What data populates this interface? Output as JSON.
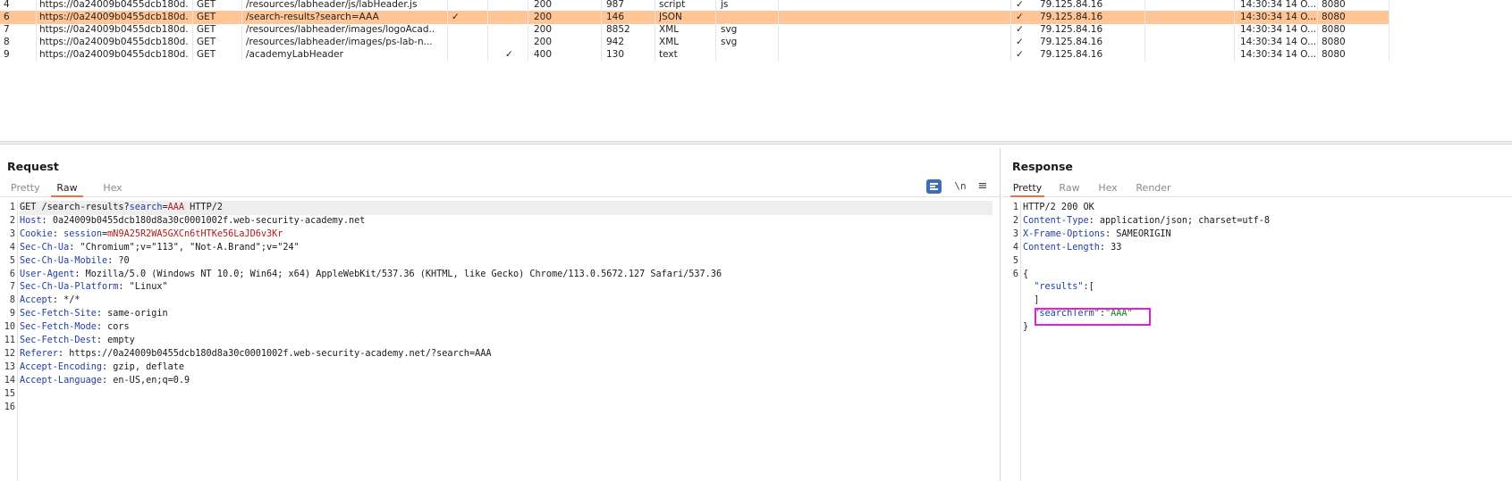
{
  "history": {
    "rows": [
      {
        "num": "4",
        "host": "https://0a24009b0455dcb180d...",
        "method": "GET",
        "url": "/resources/labheader/js/labHeader.js",
        "params": "",
        "edited": "",
        "status": "200",
        "length": "987",
        "mime": "script",
        "ext": "js",
        "tls": "✓",
        "ip": "79.125.84.16",
        "time": "14:30:34 14 O...",
        "port": "8080",
        "selected": false
      },
      {
        "num": "6",
        "host": "https://0a24009b0455dcb180d...",
        "method": "GET",
        "url": "/search-results?search=AAA",
        "params": "✓",
        "edited": "",
        "status": "200",
        "length": "146",
        "mime": "JSON",
        "ext": "",
        "tls": "✓",
        "ip": "79.125.84.16",
        "time": "14:30:34 14 O...",
        "port": "8080",
        "selected": true
      },
      {
        "num": "7",
        "host": "https://0a24009b0455dcb180d...",
        "method": "GET",
        "url": "/resources/labheader/images/logoAcad...",
        "params": "",
        "edited": "",
        "status": "200",
        "length": "8852",
        "mime": "XML",
        "ext": "svg",
        "tls": "✓",
        "ip": "79.125.84.16",
        "time": "14:30:34 14 O...",
        "port": "8080",
        "selected": false
      },
      {
        "num": "8",
        "host": "https://0a24009b0455dcb180d...",
        "method": "GET",
        "url": "/resources/labheader/images/ps-lab-n...",
        "params": "",
        "edited": "",
        "status": "200",
        "length": "942",
        "mime": "XML",
        "ext": "svg",
        "tls": "✓",
        "ip": "79.125.84.16",
        "time": "14:30:34 14 O...",
        "port": "8080",
        "selected": false
      },
      {
        "num": "9",
        "host": "https://0a24009b0455dcb180d...",
        "method": "GET",
        "url": "/academyLabHeader",
        "params": "",
        "edited": "✓",
        "status": "400",
        "length": "130",
        "mime": "text",
        "ext": "",
        "tls": "✓",
        "ip": "79.125.84.16",
        "time": "14:30:34 14 O...",
        "port": "8080",
        "selected": false
      }
    ]
  },
  "request": {
    "title": "Request",
    "tabs": [
      "Pretty",
      "Raw",
      "Hex"
    ],
    "active_tab": "Raw",
    "newline_label": "\\n",
    "menu_icon": "≡",
    "lines": [
      {
        "n": "1",
        "parts": [
          {
            "t": "GET /search-results?",
            "c": ""
          },
          {
            "t": "search",
            "c": "k"
          },
          {
            "t": "=",
            "c": ""
          },
          {
            "t": "AAA",
            "c": "v"
          },
          {
            "t": " HTTP/2",
            "c": ""
          }
        ]
      },
      {
        "n": "2",
        "parts": [
          {
            "t": "Host",
            "c": "k"
          },
          {
            "t": ": 0a24009b0455dcb180d8a30c0001002f.web-security-academy.net",
            "c": ""
          }
        ]
      },
      {
        "n": "3",
        "parts": [
          {
            "t": "Cookie",
            "c": "k"
          },
          {
            "t": ": ",
            "c": ""
          },
          {
            "t": "session",
            "c": "k"
          },
          {
            "t": "=",
            "c": ""
          },
          {
            "t": "mN9A25R2WA5GXCn6tHTKe56LaJD6v3Kr",
            "c": "v"
          }
        ]
      },
      {
        "n": "4",
        "parts": [
          {
            "t": "Sec-Ch-Ua",
            "c": "k"
          },
          {
            "t": ": \"Chromium\";v=\"113\", \"Not-A.Brand\";v=\"24\"",
            "c": ""
          }
        ]
      },
      {
        "n": "5",
        "parts": [
          {
            "t": "Sec-Ch-Ua-Mobile",
            "c": "k"
          },
          {
            "t": ": ?0",
            "c": ""
          }
        ]
      },
      {
        "n": "6",
        "parts": [
          {
            "t": "User-Agent",
            "c": "k"
          },
          {
            "t": ": Mozilla/5.0 (Windows NT 10.0; Win64; x64) AppleWebKit/537.36 (KHTML, like Gecko) Chrome/113.0.5672.127 Safari/537.36",
            "c": ""
          }
        ]
      },
      {
        "n": "7",
        "parts": [
          {
            "t": "Sec-Ch-Ua-Platform",
            "c": "k"
          },
          {
            "t": ": \"Linux\"",
            "c": ""
          }
        ]
      },
      {
        "n": "8",
        "parts": [
          {
            "t": "Accept",
            "c": "k"
          },
          {
            "t": ": */*",
            "c": ""
          }
        ]
      },
      {
        "n": "9",
        "parts": [
          {
            "t": "Sec-Fetch-Site",
            "c": "k"
          },
          {
            "t": ": same-origin",
            "c": ""
          }
        ]
      },
      {
        "n": "10",
        "parts": [
          {
            "t": "Sec-Fetch-Mode",
            "c": "k"
          },
          {
            "t": ": cors",
            "c": ""
          }
        ]
      },
      {
        "n": "11",
        "parts": [
          {
            "t": "Sec-Fetch-Dest",
            "c": "k"
          },
          {
            "t": ": empty",
            "c": ""
          }
        ]
      },
      {
        "n": "12",
        "parts": [
          {
            "t": "Referer",
            "c": "k"
          },
          {
            "t": ": https://0a24009b0455dcb180d8a30c0001002f.web-security-academy.net/?search=AAA",
            "c": ""
          }
        ]
      },
      {
        "n": "13",
        "parts": [
          {
            "t": "Accept-Encoding",
            "c": "k"
          },
          {
            "t": ": gzip, deflate",
            "c": ""
          }
        ]
      },
      {
        "n": "14",
        "parts": [
          {
            "t": "Accept-Language",
            "c": "k"
          },
          {
            "t": ": en-US,en;q=0.9",
            "c": ""
          }
        ]
      },
      {
        "n": "15",
        "parts": []
      },
      {
        "n": "16",
        "parts": []
      }
    ]
  },
  "response": {
    "title": "Response",
    "tabs": [
      "Pretty",
      "Raw",
      "Hex",
      "Render"
    ],
    "active_tab": "Pretty",
    "lines": [
      {
        "n": "1",
        "parts": [
          {
            "t": "HTTP/2 200 OK",
            "c": ""
          }
        ]
      },
      {
        "n": "2",
        "parts": [
          {
            "t": "Content-Type",
            "c": "k"
          },
          {
            "t": ": application/json; charset=utf-8",
            "c": ""
          }
        ]
      },
      {
        "n": "3",
        "parts": [
          {
            "t": "X-Frame-Options",
            "c": "k"
          },
          {
            "t": ": SAMEORIGIN",
            "c": ""
          }
        ]
      },
      {
        "n": "4",
        "parts": [
          {
            "t": "Content-Length",
            "c": "k"
          },
          {
            "t": ": 33",
            "c": ""
          }
        ]
      },
      {
        "n": "5",
        "parts": []
      },
      {
        "n": "6",
        "parts": [
          {
            "t": "{",
            "c": ""
          }
        ]
      },
      {
        "n": "",
        "parts": [
          {
            "t": "  \"results\"",
            "c": "json-key"
          },
          {
            "t": ":[",
            "c": ""
          }
        ]
      },
      {
        "n": "",
        "parts": [
          {
            "t": "  ]",
            "c": ""
          }
        ]
      },
      {
        "n": "",
        "parts": [
          {
            "t": "  \"searchTerm\"",
            "c": "json-key"
          },
          {
            "t": ":",
            "c": ""
          },
          {
            "t": "\"AAA\"",
            "c": "s"
          }
        ]
      },
      {
        "n": "",
        "parts": [
          {
            "t": "}",
            "c": ""
          }
        ]
      }
    ]
  },
  "colors": {
    "selected_row": "#ffc597",
    "accent_tab": "#e8743b",
    "highlight_box": "#e41cdd",
    "header_key": "#1f3fa0",
    "header_value": "#b41818",
    "json_string": "#1a8a1a"
  }
}
